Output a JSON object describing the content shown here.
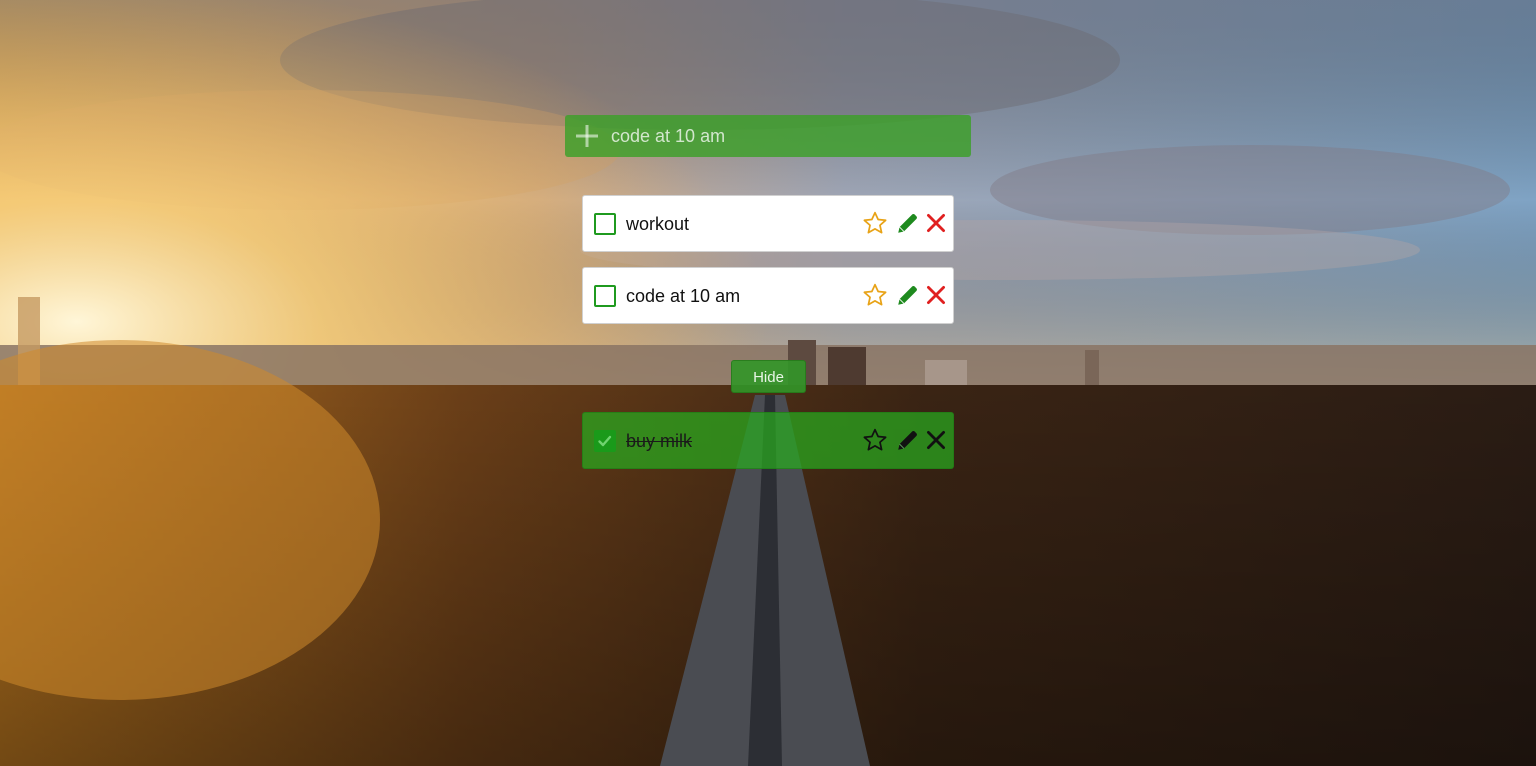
{
  "add_bar": {
    "input_value": "code at 10 am",
    "icon": "plus-icon"
  },
  "todos": [
    {
      "label": "workout",
      "completed": false
    },
    {
      "label": "code at 10 am",
      "completed": false
    },
    {
      "label": "buy milk",
      "completed": true
    }
  ],
  "hide_button": {
    "label": "Hide"
  },
  "icons": {
    "star": "star-icon",
    "edit": "pencil-icon",
    "delete": "close-icon",
    "check": "checkmark-icon"
  },
  "colors": {
    "accent_green": "#1f9a1f",
    "star_outline": "#e8a317",
    "delete_red": "#e02020"
  }
}
